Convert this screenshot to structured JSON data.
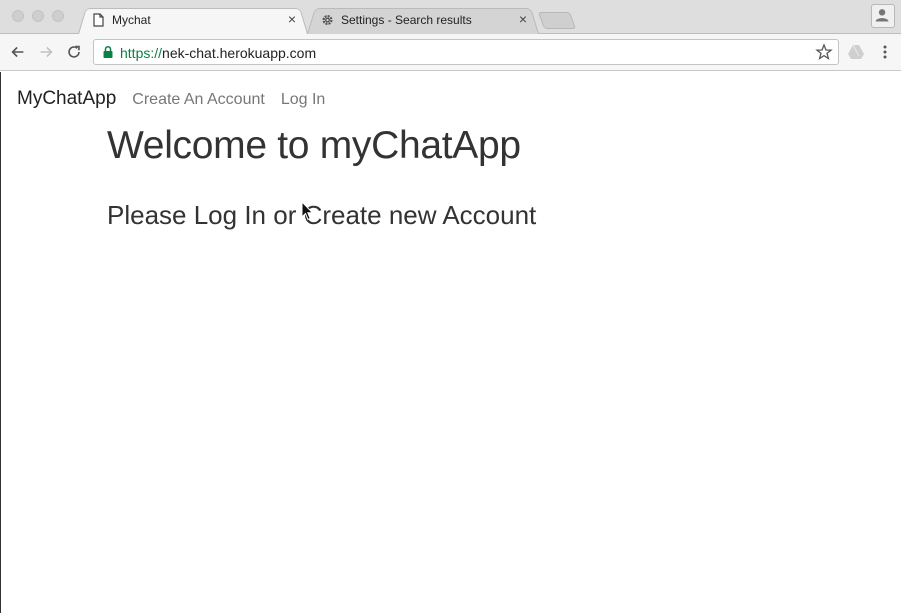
{
  "browser": {
    "tabs": [
      {
        "label": "Mychat",
        "icon": "document-icon",
        "active": true
      },
      {
        "label": "Settings - Search results",
        "icon": "gear-icon",
        "active": false
      }
    ],
    "close_glyph": "×",
    "address": {
      "scheme": "https://",
      "host": "nek-chat.herokuapp.com"
    }
  },
  "navbar": {
    "brand": "MyChatApp",
    "links": [
      {
        "label": "Create An Account"
      },
      {
        "label": "Log In"
      }
    ]
  },
  "main": {
    "title": "Welcome to myChatApp",
    "subtitle": "Please Log In or Create new Account"
  },
  "colors": {
    "secure_green": "#0b8043",
    "text_dark": "#333333",
    "link_gray": "#777777"
  }
}
